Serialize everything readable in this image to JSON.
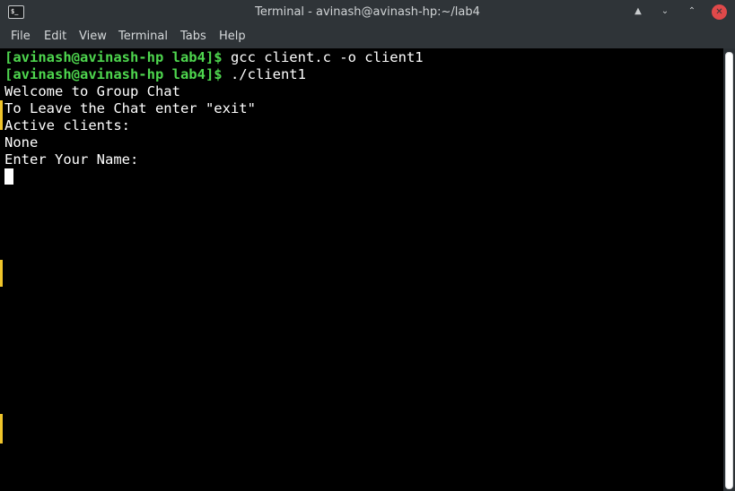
{
  "window": {
    "title": "Terminal - avinash@avinash-hp:~/lab4",
    "app_icon_text": "$_",
    "keep_above_glyph": "▲",
    "minimize_glyph": "⌄",
    "maximize_glyph": "⌃",
    "close_glyph": "✕"
  },
  "menu": [
    "File",
    "Edit",
    "View",
    "Terminal",
    "Tabs",
    "Help"
  ],
  "terminal": {
    "prompt": "[avinash@avinash-hp lab4]$",
    "command1": " gcc client.c -o client1",
    "command2": " ./client1",
    "output": [
      "Welcome to Group Chat",
      "To Leave the Chat enter \"exit\"",
      "Active clients:",
      "None",
      "Enter Your Name:"
    ]
  },
  "colors": {
    "prompt": "#4ed64e",
    "background": "#000000",
    "chrome": "#2f3438",
    "close_button": "#e0494a"
  }
}
